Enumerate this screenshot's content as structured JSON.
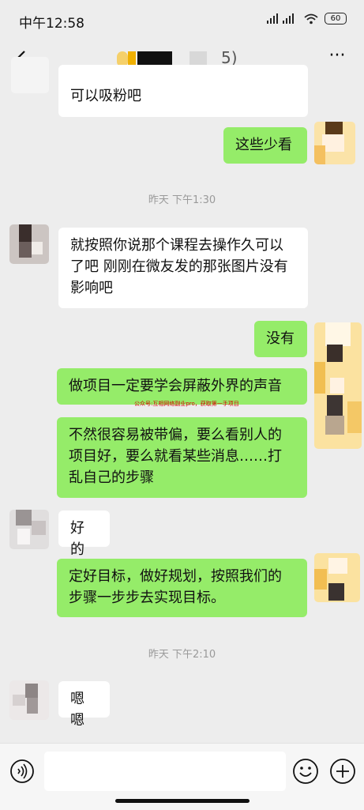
{
  "status_bar": {
    "time": "中午12:58",
    "battery": "60"
  },
  "header": {
    "title_suffix": "5)",
    "more_label": "···"
  },
  "messages": {
    "m0": {
      "line1": "",
      "line2": "可以吸粉吧"
    },
    "m1": {
      "text": "这些少看"
    },
    "t1": {
      "text": "昨天 下午1:30"
    },
    "m2": {
      "text": "就按照你说那个课程去操作久可以了吧 刚刚在微友发的那张图片没有影响吧"
    },
    "m3": {
      "text": "没有"
    },
    "m4": {
      "text": "做项目一定要学会屏蔽外界的声音"
    },
    "watermark": {
      "text": "公众号:互相网络副业pro，获取第一手项目"
    },
    "m5": {
      "text": "不然很容易被带偏，要么看别人的项目好，要么就看某些消息……打乱自己的步骤"
    },
    "m6": {
      "text": "好的"
    },
    "m7": {
      "text": "定好目标，做好规划，按照我们的步骤一步步去实现目标。"
    },
    "t2": {
      "text": "昨天 下午2:10"
    },
    "m8": {
      "text": "嗯嗯"
    }
  },
  "input_bar": {
    "placeholder": ""
  },
  "colors": {
    "background": "#ededed",
    "incoming_bubble": "#ffffff",
    "outgoing_bubble": "#95ec69"
  }
}
